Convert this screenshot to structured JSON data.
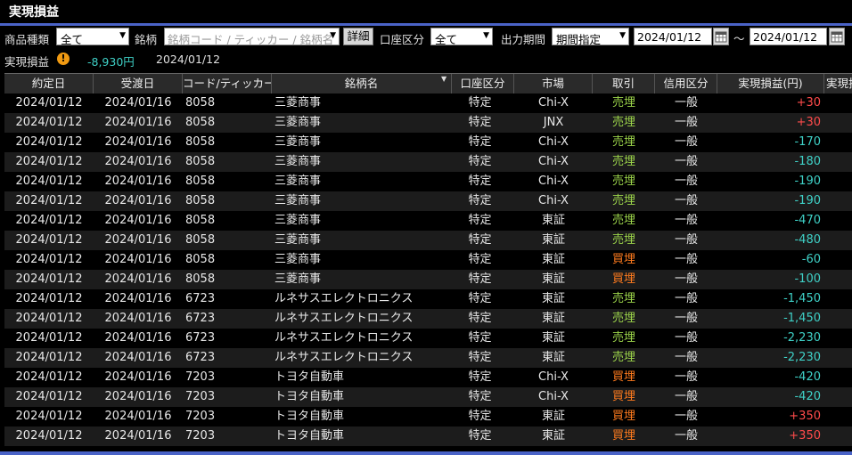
{
  "title": "実現損益",
  "filters": {
    "product_type_label": "商品種類",
    "product_type_value": "全て",
    "symbol_label": "銘柄",
    "symbol_placeholder": "銘柄コード / ティッカー / 銘柄名",
    "detail_button": "詳細",
    "account_label": "口座区分",
    "account_value": "全て",
    "period_label": "出力期間",
    "period_value": "期間指定",
    "date_from": "2024/01/12",
    "date_separator": "～",
    "date_to": "2024/01/12"
  },
  "summary": {
    "label": "実現損益",
    "warning_icon": "!",
    "value": "-8,930円",
    "date": "2024/01/12"
  },
  "columns": [
    "約定日",
    "受渡日",
    "コード/ティッカー",
    "銘柄名",
    "口座区分",
    "市場",
    "取引",
    "信用区分",
    "実現損益(円)",
    "実現損"
  ],
  "rows": [
    {
      "trade_date": "2024/01/12",
      "settle_date": "2024/01/16",
      "code": "8058",
      "name": "三菱商事",
      "account": "特定",
      "market": "Chi-X",
      "trade": "売埋",
      "credit": "一般",
      "pl": "+30"
    },
    {
      "trade_date": "2024/01/12",
      "settle_date": "2024/01/16",
      "code": "8058",
      "name": "三菱商事",
      "account": "特定",
      "market": "JNX",
      "trade": "売埋",
      "credit": "一般",
      "pl": "+30"
    },
    {
      "trade_date": "2024/01/12",
      "settle_date": "2024/01/16",
      "code": "8058",
      "name": "三菱商事",
      "account": "特定",
      "market": "Chi-X",
      "trade": "売埋",
      "credit": "一般",
      "pl": "-170"
    },
    {
      "trade_date": "2024/01/12",
      "settle_date": "2024/01/16",
      "code": "8058",
      "name": "三菱商事",
      "account": "特定",
      "market": "Chi-X",
      "trade": "売埋",
      "credit": "一般",
      "pl": "-180"
    },
    {
      "trade_date": "2024/01/12",
      "settle_date": "2024/01/16",
      "code": "8058",
      "name": "三菱商事",
      "account": "特定",
      "market": "Chi-X",
      "trade": "売埋",
      "credit": "一般",
      "pl": "-190"
    },
    {
      "trade_date": "2024/01/12",
      "settle_date": "2024/01/16",
      "code": "8058",
      "name": "三菱商事",
      "account": "特定",
      "market": "Chi-X",
      "trade": "売埋",
      "credit": "一般",
      "pl": "-190"
    },
    {
      "trade_date": "2024/01/12",
      "settle_date": "2024/01/16",
      "code": "8058",
      "name": "三菱商事",
      "account": "特定",
      "market": "東証",
      "trade": "売埋",
      "credit": "一般",
      "pl": "-470"
    },
    {
      "trade_date": "2024/01/12",
      "settle_date": "2024/01/16",
      "code": "8058",
      "name": "三菱商事",
      "account": "特定",
      "market": "東証",
      "trade": "売埋",
      "credit": "一般",
      "pl": "-480"
    },
    {
      "trade_date": "2024/01/12",
      "settle_date": "2024/01/16",
      "code": "8058",
      "name": "三菱商事",
      "account": "特定",
      "market": "東証",
      "trade": "買埋",
      "credit": "一般",
      "pl": "-60"
    },
    {
      "trade_date": "2024/01/12",
      "settle_date": "2024/01/16",
      "code": "8058",
      "name": "三菱商事",
      "account": "特定",
      "market": "東証",
      "trade": "買埋",
      "credit": "一般",
      "pl": "-100"
    },
    {
      "trade_date": "2024/01/12",
      "settle_date": "2024/01/16",
      "code": "6723",
      "name": "ルネサスエレクトロニクス",
      "account": "特定",
      "market": "東証",
      "trade": "売埋",
      "credit": "一般",
      "pl": "-1,450"
    },
    {
      "trade_date": "2024/01/12",
      "settle_date": "2024/01/16",
      "code": "6723",
      "name": "ルネサスエレクトロニクス",
      "account": "特定",
      "market": "東証",
      "trade": "売埋",
      "credit": "一般",
      "pl": "-1,450"
    },
    {
      "trade_date": "2024/01/12",
      "settle_date": "2024/01/16",
      "code": "6723",
      "name": "ルネサスエレクトロニクス",
      "account": "特定",
      "market": "東証",
      "trade": "売埋",
      "credit": "一般",
      "pl": "-2,230"
    },
    {
      "trade_date": "2024/01/12",
      "settle_date": "2024/01/16",
      "code": "6723",
      "name": "ルネサスエレクトロニクス",
      "account": "特定",
      "market": "東証",
      "trade": "売埋",
      "credit": "一般",
      "pl": "-2,230"
    },
    {
      "trade_date": "2024/01/12",
      "settle_date": "2024/01/16",
      "code": "7203",
      "name": "トヨタ自動車",
      "account": "特定",
      "market": "Chi-X",
      "trade": "買埋",
      "credit": "一般",
      "pl": "-420"
    },
    {
      "trade_date": "2024/01/12",
      "settle_date": "2024/01/16",
      "code": "7203",
      "name": "トヨタ自動車",
      "account": "特定",
      "market": "Chi-X",
      "trade": "買埋",
      "credit": "一般",
      "pl": "-420"
    },
    {
      "trade_date": "2024/01/12",
      "settle_date": "2024/01/16",
      "code": "7203",
      "name": "トヨタ自動車",
      "account": "特定",
      "market": "東証",
      "trade": "買埋",
      "credit": "一般",
      "pl": "+350"
    },
    {
      "trade_date": "2024/01/12",
      "settle_date": "2024/01/16",
      "code": "7203",
      "name": "トヨタ自動車",
      "account": "特定",
      "market": "東証",
      "trade": "買埋",
      "credit": "一般",
      "pl": "+350"
    }
  ],
  "colors": {
    "accent_blue": "#4a63c7",
    "sell_close": "#9bd34a",
    "buy_close": "#ff7b1e",
    "profit": "#ff4b4b",
    "loss": "#3fd1c7"
  },
  "icons": {
    "dropdown": "chevron-down-icon",
    "calendar": "calendar-icon",
    "warning": "warning-icon",
    "sort": "sort-desc-icon"
  }
}
